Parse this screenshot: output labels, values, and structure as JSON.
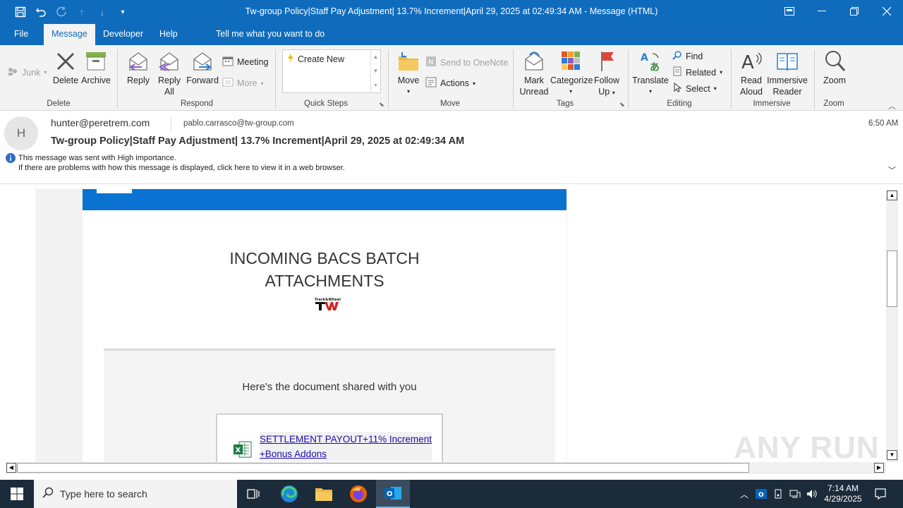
{
  "window": {
    "title": "Tw-group Policy|Staff Pay Adjustment| 13.7% Increment|April 29, 2025 at 02:49:34 AM  -  Message (HTML)"
  },
  "menu": {
    "file": "File",
    "message": "Message",
    "developer": "Developer",
    "help": "Help",
    "tell_me": "Tell me what you want to do"
  },
  "ribbon": {
    "junk": "Junk",
    "delete": "Delete",
    "archive": "Archive",
    "reply": "Reply",
    "reply_all_1": "Reply",
    "reply_all_2": "All",
    "forward": "Forward",
    "meeting": "Meeting",
    "more": "More",
    "create_new": "Create New",
    "move": "Move",
    "send_onenote": "Send to OneNote",
    "actions": "Actions",
    "mark_unread_1": "Mark",
    "mark_unread_2": "Unread",
    "categorize": "Categorize",
    "follow_up_1": "Follow",
    "follow_up_2": "Up",
    "translate": "Translate",
    "find": "Find",
    "related": "Related",
    "select": "Select",
    "read_aloud_1": "Read",
    "read_aloud_2": "Aloud",
    "immersive_1": "Immersive",
    "immersive_2": "Reader",
    "zoom": "Zoom",
    "groups": {
      "delete": "Delete",
      "respond": "Respond",
      "quick_steps": "Quick Steps",
      "move": "Move",
      "tags": "Tags",
      "editing": "Editing",
      "immersive": "Immersive",
      "zoom": "Zoom"
    }
  },
  "message": {
    "avatar_letter": "H",
    "from": "hunter@peretrem.com",
    "to": "pablo.carrasco@tw-group.com",
    "time": "6:50 AM",
    "subject": "Tw-group Policy|Staff Pay Adjustment| 13.7% Increment|April 29, 2025 at 02:49:34 AM",
    "info_line1": "This message was sent with High importance.",
    "info_line2": "If there are problems with how this message is displayed, click here to view it in a web browser."
  },
  "email": {
    "heading_1": "INCOMING BACS BATCH",
    "heading_2": "ATTACHMENTS",
    "logo_text": "Track&Wheel",
    "shared_text": "Here's the document shared with you",
    "doc_link_1": "SETTLEMENT PAYOUT+11% Increment",
    "doc_link_2": "+Bonus Addons"
  },
  "taskbar": {
    "search_placeholder": "Type here to search",
    "time": "7:14 AM",
    "date": "4/29/2025"
  },
  "watermark": "ANY RUN",
  "colors": {
    "accent": "#0f6cbd",
    "email_banner": "#0a73d1",
    "taskbar": "#1c2b3a"
  }
}
